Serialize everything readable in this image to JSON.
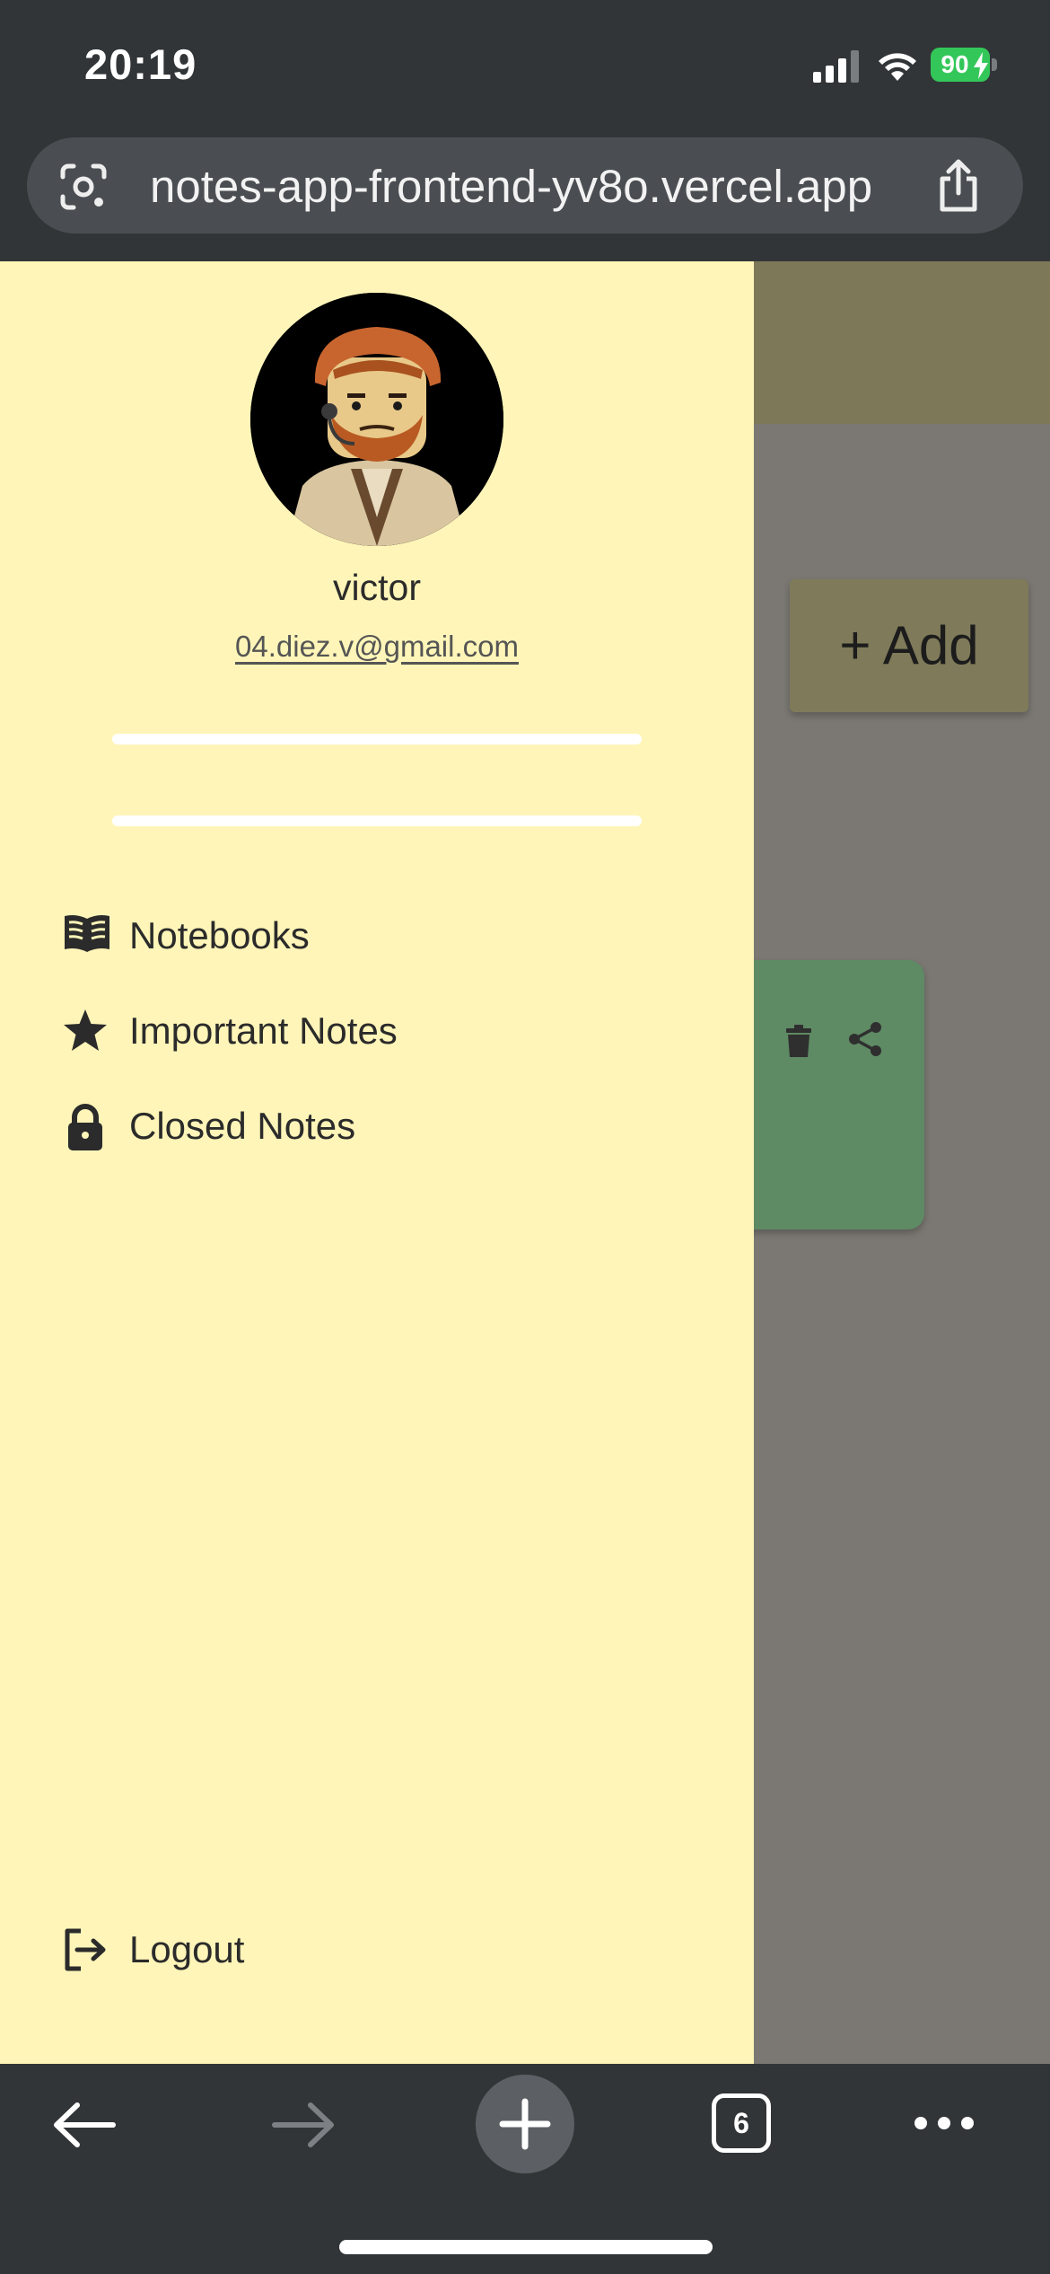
{
  "status_bar": {
    "time": "20:19",
    "battery": "90"
  },
  "browser": {
    "url": "notes-app-frontend-yv8o.vercel.app",
    "tab_count": "6"
  },
  "page": {
    "add_button": "+ Add"
  },
  "drawer": {
    "username": "victor",
    "email": "04.diez.v@gmail.com",
    "menu": [
      {
        "label": "Notebooks",
        "icon": "book-icon"
      },
      {
        "label": "Important Notes",
        "icon": "star-icon"
      },
      {
        "label": "Closed Notes",
        "icon": "lock-icon"
      }
    ],
    "logout": "Logout"
  },
  "colors": {
    "drawer_bg": "#fff5b8",
    "overlay_bg": "#7b7873",
    "note_card": "#5e8a64",
    "browser_chrome": "#323538",
    "battery": "#33c759"
  }
}
